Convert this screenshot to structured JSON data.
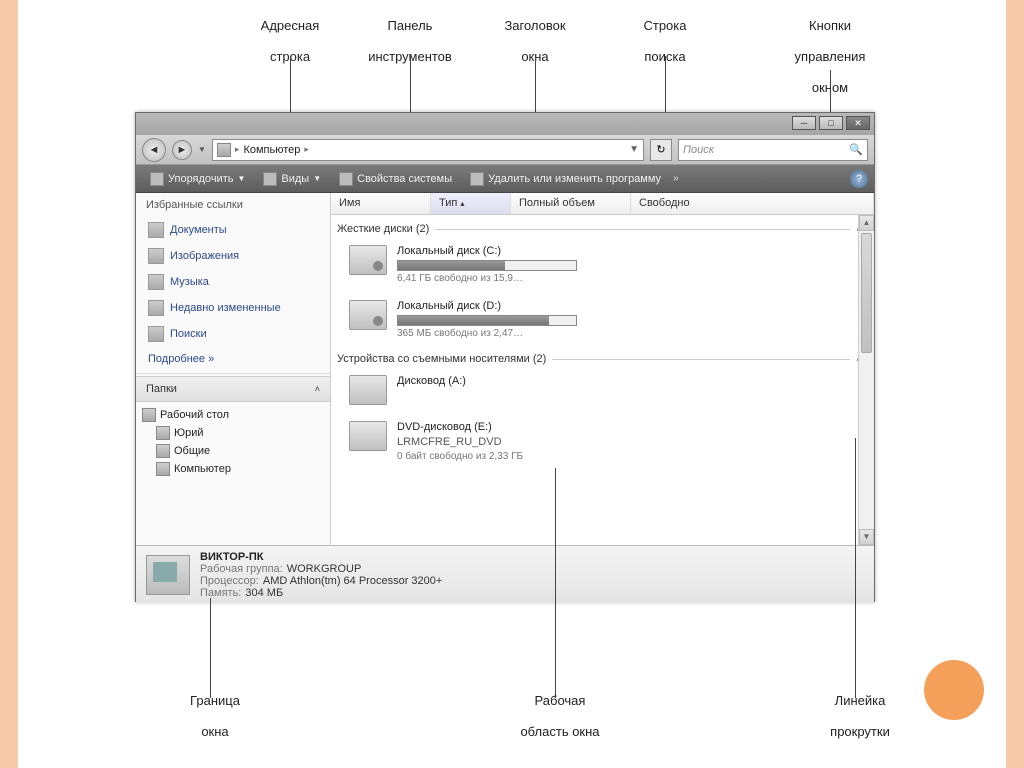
{
  "topLabels": {
    "address": "Адресная\nстрока",
    "toolbar": "Панель\nинструментов",
    "title": "Заголовок\nокна",
    "search": "Строка\nпоиска",
    "winbtns": "Кнопки\nуправления\nокном"
  },
  "bottomLabels": {
    "border": "Граница\nокна",
    "workarea": "Рабочая\nобласть окна",
    "scrollbar": "Линейка\nпрокрутки"
  },
  "address": {
    "root": "Компьютер",
    "sep": "▸"
  },
  "search": {
    "placeholder": "Поиск"
  },
  "toolbar": {
    "organize": "Упорядочить",
    "views": "Виды",
    "sysprops": "Свойства системы",
    "uninstall": "Удалить или изменить программу",
    "more": "»"
  },
  "sidebar": {
    "favHeader": "Избранные ссылки",
    "links": [
      "Документы",
      "Изображения",
      "Музыка",
      "Недавно измененные",
      "Поиски"
    ],
    "more": "Подробнее  »",
    "foldersHeader": "Папки",
    "tree": {
      "desktop": "Рабочий стол",
      "user": "Юрий",
      "public": "Общие",
      "computer": "Компьютер"
    }
  },
  "columns": {
    "name": "Имя",
    "type": "Тип",
    "total": "Полный объем",
    "free": "Свободно"
  },
  "groups": {
    "hdd": "Жесткие диски (2)",
    "removable": "Устройства со съемными носителями (2)"
  },
  "drives": {
    "c": {
      "name": "Локальный диск (C:)",
      "sub": "6,41 ГБ свободно из 15,9…",
      "fill": 60
    },
    "d": {
      "name": "Локальный диск (D:)",
      "sub": "365 МБ свободно из 2,47…",
      "fill": 85
    },
    "a": {
      "name": "Дисковод (A:)"
    },
    "e": {
      "name": "DVD-дисковод (E:)",
      "label": "LRMCFRE_RU_DVD",
      "sub": "0 байт свободно из 2,33 ГБ"
    }
  },
  "details": {
    "title": "ВИКТОР-ПК",
    "workgroupL": "Рабочая группа:",
    "workgroup": "WORKGROUP",
    "cpuL": "Процессор:",
    "cpu": "AMD Athlon(tm) 64 Processor 3200+",
    "memL": "Память:",
    "mem": "304 МБ"
  }
}
